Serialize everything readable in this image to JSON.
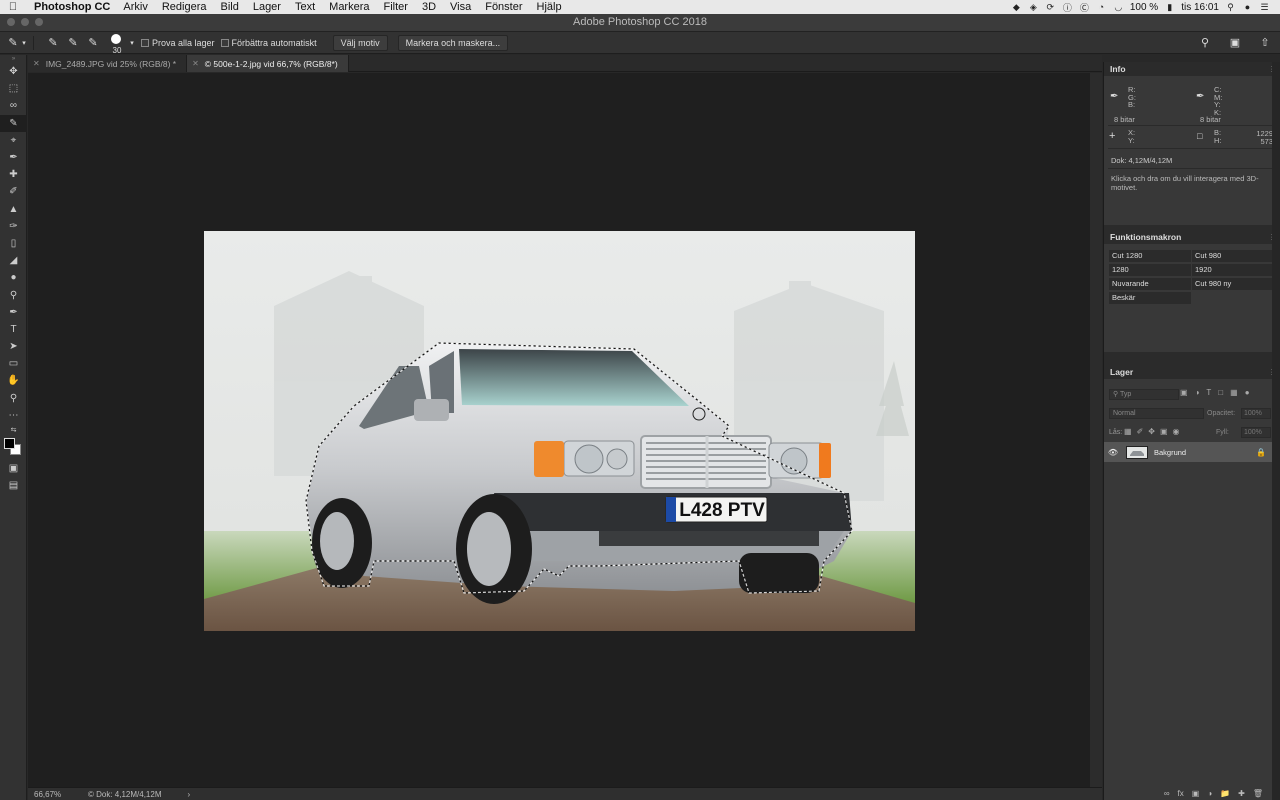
{
  "menubar": {
    "app_name": "Photoshop CC",
    "items": [
      "Arkiv",
      "Redigera",
      "Bild",
      "Lager",
      "Text",
      "Markera",
      "Filter",
      "3D",
      "Visa",
      "Fönster",
      "Hjälp"
    ],
    "battery": "100 %",
    "clock": "tis 16:01"
  },
  "window": {
    "title": "Adobe Photoshop CC 2018"
  },
  "options": {
    "brush_size": "30",
    "sample_all_layers": "Prova alla lager",
    "auto_enhance": "Förbättra automatiskt",
    "select_subject": "Välj motiv",
    "select_and_mask": "Markera och maskera..."
  },
  "tabs": [
    {
      "label": "IMG_2489.JPG vid 25% (RGB/8) *"
    },
    {
      "label": "© 500e-1-2.jpg vid 66,7% (RGB/8*)"
    }
  ],
  "status": {
    "zoom": "66,67%",
    "doc": "© Dok: 4,12M/4,12M",
    "arrow": "›"
  },
  "photo": {
    "plate": "L428 PTV"
  },
  "info": {
    "title": "Info",
    "rgb_labels": "R:\nG:\nB:",
    "cmyk_labels": "C:\nM:\nY:\nK:",
    "bits_left": "8 bitar",
    "bits_right": "8 bitar",
    "xy_labels": "X:\nY:",
    "bh_labels": "B:\nH:",
    "width_value": "1229",
    "height_value": "573",
    "doc": "Dok: 4,12M/4,12M",
    "hint": "Klicka och dra om du vill interagera med 3D-motivet."
  },
  "actions": {
    "title": "Funktionsmakron",
    "cells": [
      "Cut 1280",
      "Cut 980",
      "1280",
      "1920",
      "Nuvarande",
      "Cut 980 ny",
      "Beskär"
    ]
  },
  "layers": {
    "title": "Lager",
    "search_placeholder": "Typ",
    "blend_mode": "Normal",
    "opacity_label": "Opacitet:",
    "opacity_value": "100%",
    "lock_label": "Lås:",
    "fill_label": "Fyll:",
    "fill_value": "100%",
    "layer_name": "Bakgrund"
  }
}
